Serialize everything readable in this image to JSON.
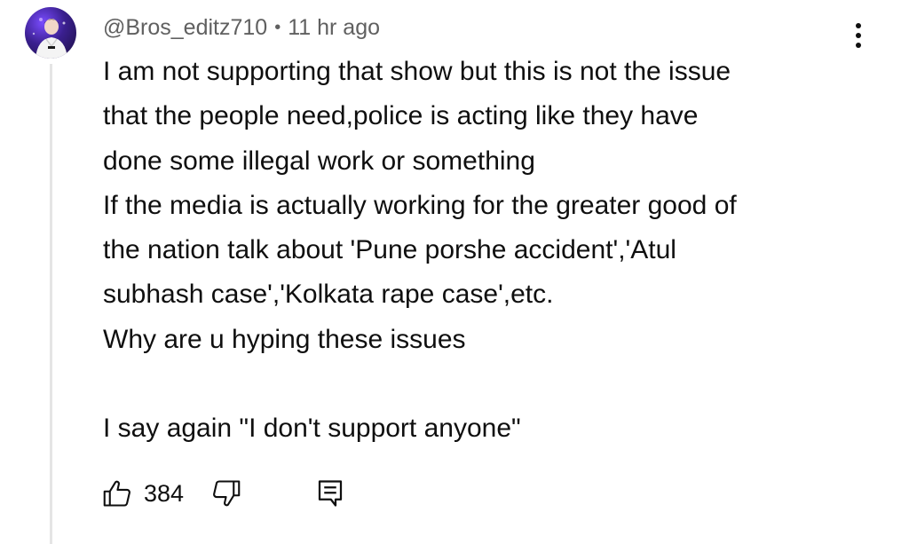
{
  "comment": {
    "author": "@Bros_editz710",
    "separator": "•",
    "time": "11 hr ago",
    "lines": [
      "I am not supporting that show but this is not the issue",
      "that the people need,police is acting like they have",
      "done some illegal work or something",
      "If the media is actually working for the greater good of",
      "the nation talk about 'Pune porshe accident','Atul",
      "subhash case','Kolkata rape case',etc.",
      "Why are u hyping these issues",
      "",
      "I say again \"I don't support anyone\""
    ],
    "like_count": "384"
  },
  "icons": {
    "avatar": "user-avatar",
    "more": "more-vertical-icon",
    "like": "thumbs-up-icon",
    "dislike": "thumbs-down-icon",
    "reply": "reply-comment-icon"
  },
  "colors": {
    "text": "#0f0f0f",
    "meta": "#606060",
    "thread_line": "#e5e5e5"
  }
}
